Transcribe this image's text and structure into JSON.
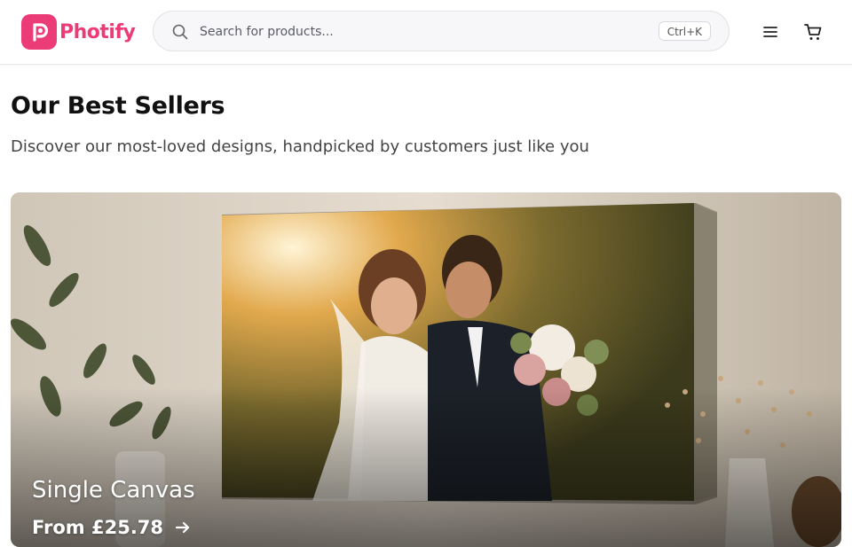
{
  "brand": {
    "name": "Photify",
    "color": "#ec3c78"
  },
  "search": {
    "placeholder": "Search for products...",
    "shortcut": "Ctrl+K"
  },
  "header": {
    "menu_icon": "menu-icon",
    "cart_icon": "cart-icon"
  },
  "section": {
    "title": "Our Best Sellers",
    "subtitle": "Discover our most-loved designs, handpicked by customers just like you"
  },
  "products": [
    {
      "name": "Single Canvas",
      "price": "From £25.78",
      "arrow_icon": "arrow-right-icon"
    }
  ]
}
